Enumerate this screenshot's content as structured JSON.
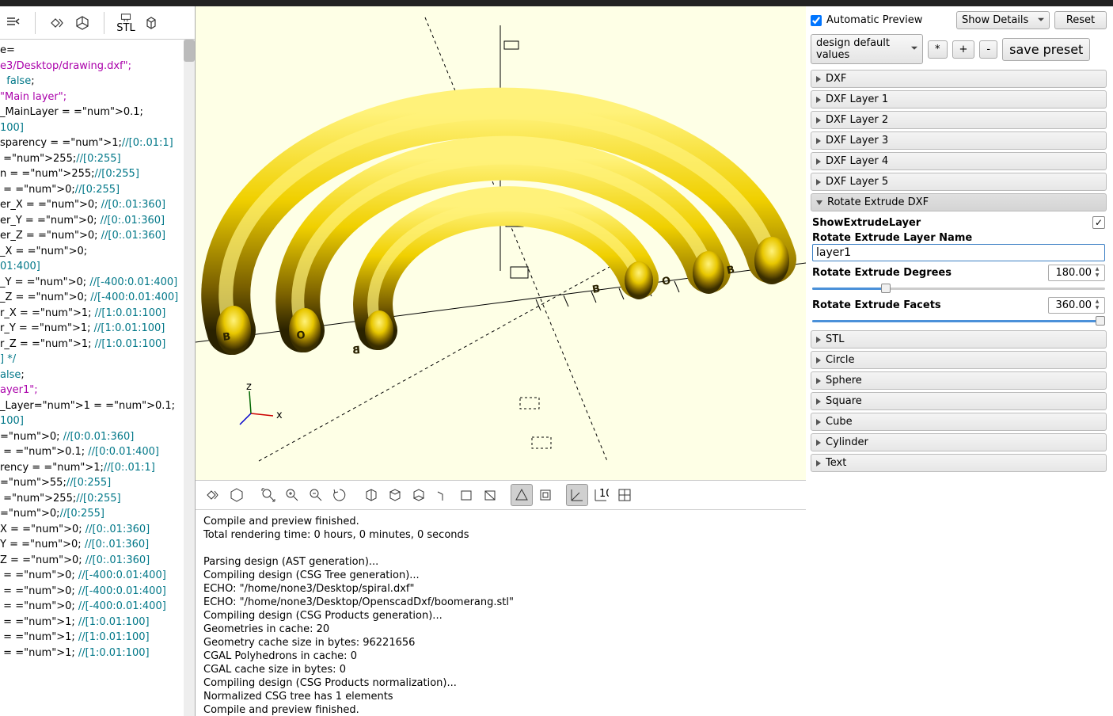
{
  "topControls": {
    "autoPreview": "Automatic Preview",
    "showDetails": "Show Details",
    "reset": "Reset",
    "designDefault": "design default values",
    "star": "*",
    "plus": "+",
    "minus": "-",
    "savePreset": "save preset"
  },
  "accordions": {
    "dxf": "DXF",
    "dxfL1": "DXF Layer 1",
    "dxfL2": "DXF Layer 2",
    "dxfL3": "DXF Layer 3",
    "dxfL4": "DXF Layer 4",
    "dxfL5": "DXF Layer 5",
    "rotExt": "Rotate Extrude DXF",
    "stl": "STL",
    "circle": "Circle",
    "sphere": "Sphere",
    "square": "Square",
    "cube": "Cube",
    "cylinder": "Cylinder",
    "text": "Text"
  },
  "rotateExtrude": {
    "showLabel": "ShowExtrudeLayer",
    "showChecked": true,
    "layerNameLabel": "Rotate Extrude Layer Name",
    "layerNameValue": "layer1",
    "degreesLabel": "Rotate Extrude Degrees",
    "degreesValue": "180.00",
    "degreesPct": 25,
    "facetsLabel": "Rotate Extrude Facets",
    "facetsValue": "360.00",
    "facetsPct": 100
  },
  "console": "Compile and preview finished.\nTotal rendering time: 0 hours, 0 minutes, 0 seconds\n\nParsing design (AST generation)...\nCompiling design (CSG Tree generation)...\nECHO: \"/home/none3/Desktop/spiral.dxf\"\nECHO: \"/home/none3/Desktop/OpenscadDxf/boomerang.stl\"\nCompiling design (CSG Products generation)...\nGeometries in cache: 20\nGeometry cache size in bytes: 96221656\nCGAL Polyhedrons in cache: 0\nCGAL cache size in bytes: 0\nCompiling design (CSG Products normalization)...\nNormalized CSG tree has 1 elements\nCompile and preview finished.\nTotal rendering time: 0 hours, 0 minutes, 0 seconds",
  "code": [
    {
      "t": "e="
    },
    {
      "t": "e3/Desktop/drawing.dxf\";",
      "cls": "str"
    },
    {
      "t": " false;",
      "pre": " ",
      "cls": "kw"
    },
    {
      "t": "\"Main layer\";",
      "cls": "str"
    },
    {
      "t": "_MainLayer = 0.1;",
      "num": "0.1"
    },
    {
      "t": "100]",
      "cls": "cmt"
    },
    {
      "t": "sparency = 1;//[0:.01:1]",
      "num": "1",
      "cmt": "//[0:.01:1]"
    },
    {
      "t": " 255;//[0:255]",
      "num": "255",
      "cmt": "//[0:255]"
    },
    {
      "t": "n = 255;//[0:255]",
      "num": "255",
      "cmt": "//[0:255]"
    },
    {
      "t": " = 0;//[0:255]",
      "num": "0",
      "cmt": "//[0:255]"
    },
    {
      "t": "er_X = 0; //[0:.01:360]",
      "num": "0",
      "cmt": "//[0:.01:360]"
    },
    {
      "t": "er_Y = 0; //[0:.01:360]",
      "num": "0",
      "cmt": "//[0:.01:360]"
    },
    {
      "t": "er_Z = 0; //[0:.01:360]",
      "num": "0",
      "cmt": "//[0:.01:360]"
    },
    {
      "t": "_X = 0;",
      "num": "0"
    },
    {
      "t": "01:400]",
      "cls": "cmt"
    },
    {
      "t": "_Y = 0; //[-400:0.01:400]",
      "num": "0",
      "cmt": "//[-400:0.01:400]"
    },
    {
      "t": "_Z = 0; //[-400:0.01:400]",
      "num": "0",
      "cmt": "//[-400:0.01:400]"
    },
    {
      "t": "r_X = 1; //[1:0.01:100]",
      "num": "1",
      "cmt": "//[1:0.01:100]"
    },
    {
      "t": "r_Y = 1; //[1:0.01:100]",
      "num": "1",
      "cmt": "//[1:0.01:100]"
    },
    {
      "t": "r_Z = 1; //[1:0.01:100]",
      "num": "1",
      "cmt": "//[1:0.01:100]"
    },
    {
      "t": ""
    },
    {
      "t": "] */",
      "cls": "cmt"
    },
    {
      "t": "alse;",
      "cls": "kw"
    },
    {
      "t": "ayer1\";",
      "cls": "str"
    },
    {
      "t": "_Layer1 = 0.1;",
      "num": "0.1"
    },
    {
      "t": "100]",
      "cls": "cmt"
    },
    {
      "t": "0; //[0:0.01:360]",
      "num": "0",
      "cmt": "//[0:0.01:360]"
    },
    {
      "t": " = 0.1; //[0:0.01:400]",
      "num": "0.1",
      "cmt": "//[0:0.01:400]"
    },
    {
      "t": "rency = 1;//[0:.01:1]",
      "num": "1",
      "cmt": "//[0:.01:1]"
    },
    {
      "t": "55;//[0:255]",
      "num": "5",
      "cmt": "//[0:255]"
    },
    {
      "t": " 255;//[0:255]",
      "num": "255",
      "cmt": "//[0:255]"
    },
    {
      "t": "0;//[0:255]",
      "num": "0",
      "cmt": "//[0:255]"
    },
    {
      "t": "X = 0; //[0:.01:360]",
      "num": "0",
      "cmt": "//[0:.01:360]"
    },
    {
      "t": "Y = 0; //[0:.01:360]",
      "num": "0",
      "cmt": "//[0:.01:360]"
    },
    {
      "t": "Z = 0; //[0:.01:360]",
      "num": "0",
      "cmt": "//[0:.01:360]"
    },
    {
      "t": " = 0; //[-400:0.01:400]",
      "num": "0",
      "cmt": "//[-400:0.01:400]"
    },
    {
      "t": " = 0; //[-400:0.01:400]",
      "num": "0",
      "cmt": "//[-400:0.01:400]"
    },
    {
      "t": " = 0; //[-400:0.01:400]",
      "num": "0",
      "cmt": "//[-400:0.01:400]"
    },
    {
      "t": " = 1; //[1:0.01:100]",
      "num": "1",
      "cmt": "//[1:0.01:100]"
    },
    {
      "t": " = 1; //[1:0.01:100]",
      "num": "1",
      "cmt": "//[1:0.01:100]"
    },
    {
      "t": " = 1; //[1:0.01:100]",
      "num": "1",
      "cmt": "//[1:0.01:100]"
    }
  ],
  "axisLabels": {
    "x": "x",
    "z": "z"
  }
}
